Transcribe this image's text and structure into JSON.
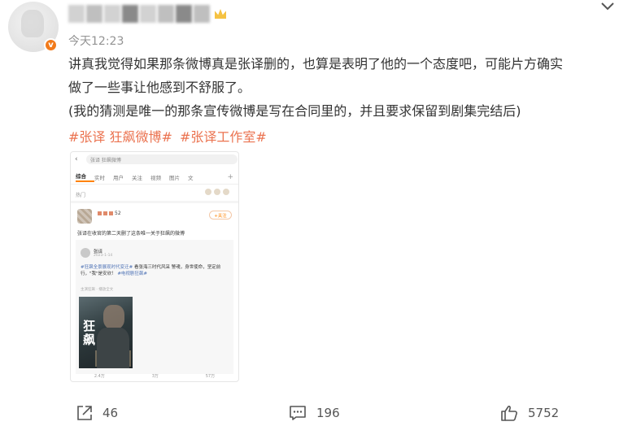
{
  "post": {
    "time": "今天12:23",
    "verified_badge": "v",
    "content_line1": "讲真我觉得如果那条微博真是张译删的，也算是表明了他的一个态度吧，可能片方确实",
    "content_line2": "做了一些事让他感到不舒服了。",
    "content_line3": "(我的猜测是唯一的那条宣传微博是写在合同里的，并且要求保留到剧集完结后)",
    "hashtags": [
      "#张译 狂飙微博#",
      "#张译工作室#"
    ],
    "hashtag_color": "#eb7350"
  },
  "embedded_image": {
    "search_query": "张译 狂飙微博",
    "tabs": [
      "综合",
      "实时",
      "用户",
      "关注",
      "视频",
      "图片",
      "文"
    ],
    "hot_label": "热门",
    "follow_label": "+关注",
    "post_user_count": "52",
    "post_text": "张译在收官的第二天删了这条唯一关于狂飙的微博",
    "quote_name": "张译",
    "quote_date": "2023-1-14",
    "quote_text_blue": "#狂飙全景展现时代变迁#",
    "quote_text": "看张海三时代风采 警魂，身世使命，坚定前行，\"我\"是安欣！",
    "quote_text_tag": "#电视剧狂飙#",
    "quote_sub": "主演狂飙 · 播放全文",
    "poster_title": "狂飙",
    "shot_shares": "2.4万",
    "shot_comments": "3万",
    "shot_likes": "57万"
  },
  "actions": {
    "share_count": "46",
    "comment_count": "196",
    "like_count": "5752"
  },
  "icons": {
    "share": "share-icon",
    "comment": "comment-icon",
    "like": "thumbs-up-icon",
    "more": "chevron-down-icon"
  }
}
